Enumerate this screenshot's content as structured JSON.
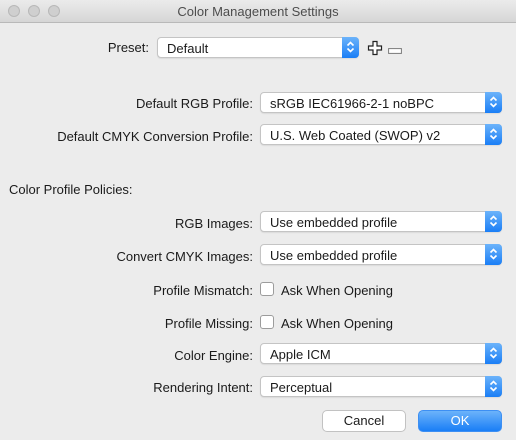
{
  "window": {
    "title": "Color Management Settings"
  },
  "preset": {
    "label": "Preset:",
    "value": "Default",
    "add_icon": "plus-icon",
    "remove_icon": "minus-icon"
  },
  "working_spaces": {
    "rgb_label": "Default RGB Profile:",
    "rgb_value": "sRGB IEC61966-2-1 noBPC",
    "cmyk_label": "Default CMYK Conversion Profile:",
    "cmyk_value": "U.S. Web Coated (SWOP) v2"
  },
  "policies": {
    "heading": "Color Profile Policies:",
    "rgb_images_label": "RGB Images:",
    "rgb_images_value": "Use embedded profile",
    "convert_cmyk_label": "Convert CMYK Images:",
    "convert_cmyk_value": "Use embedded profile",
    "mismatch_label": "Profile Mismatch:",
    "mismatch_checkbox": "Ask When Opening",
    "mismatch_checked": false,
    "missing_label": "Profile Missing:",
    "missing_checkbox": "Ask When Opening",
    "missing_checked": false
  },
  "conversion": {
    "engine_label": "Color Engine:",
    "engine_value": "Apple ICM",
    "intent_label": "Rendering Intent:",
    "intent_value": "Perceptual"
  },
  "buttons": {
    "cancel": "Cancel",
    "ok": "OK"
  },
  "colors": {
    "accent": "#1a7ef6",
    "background": "#ececec"
  }
}
